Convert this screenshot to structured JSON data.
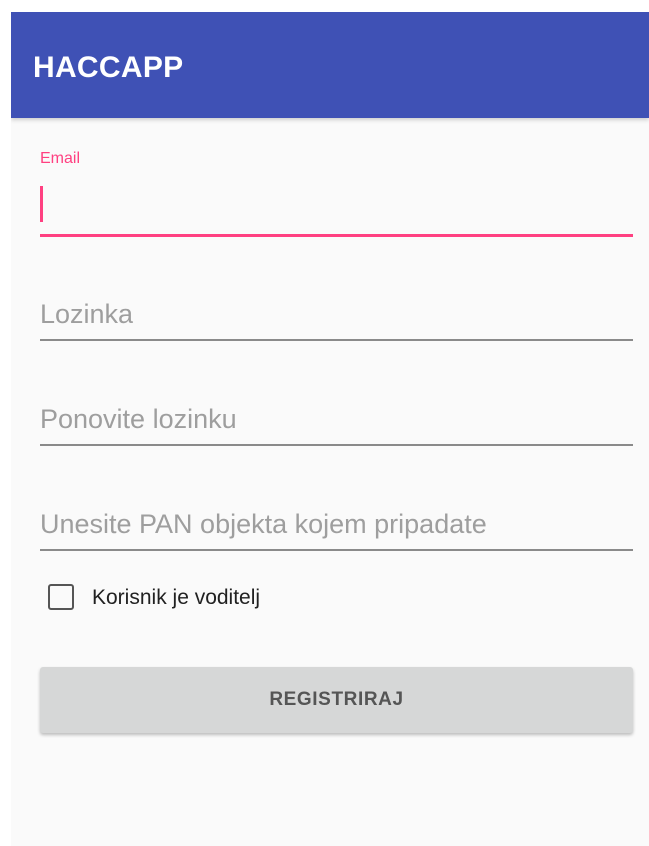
{
  "app_bar": {
    "title": "HACCAPP",
    "background_color": "#3f51b5"
  },
  "form": {
    "email": {
      "label": "Email",
      "value": "",
      "focused": true,
      "accent_color": "#ff4081"
    },
    "password": {
      "placeholder": "Lozinka",
      "value": ""
    },
    "password_repeat": {
      "placeholder": "Ponovite lozinku",
      "value": ""
    },
    "pan": {
      "placeholder": "Unesite PAN objekta kojem pripadate",
      "value": ""
    },
    "manager_checkbox": {
      "label": "Korisnik je voditelj",
      "checked": false
    },
    "register_button": {
      "label": "REGISTRIRAJ"
    }
  }
}
